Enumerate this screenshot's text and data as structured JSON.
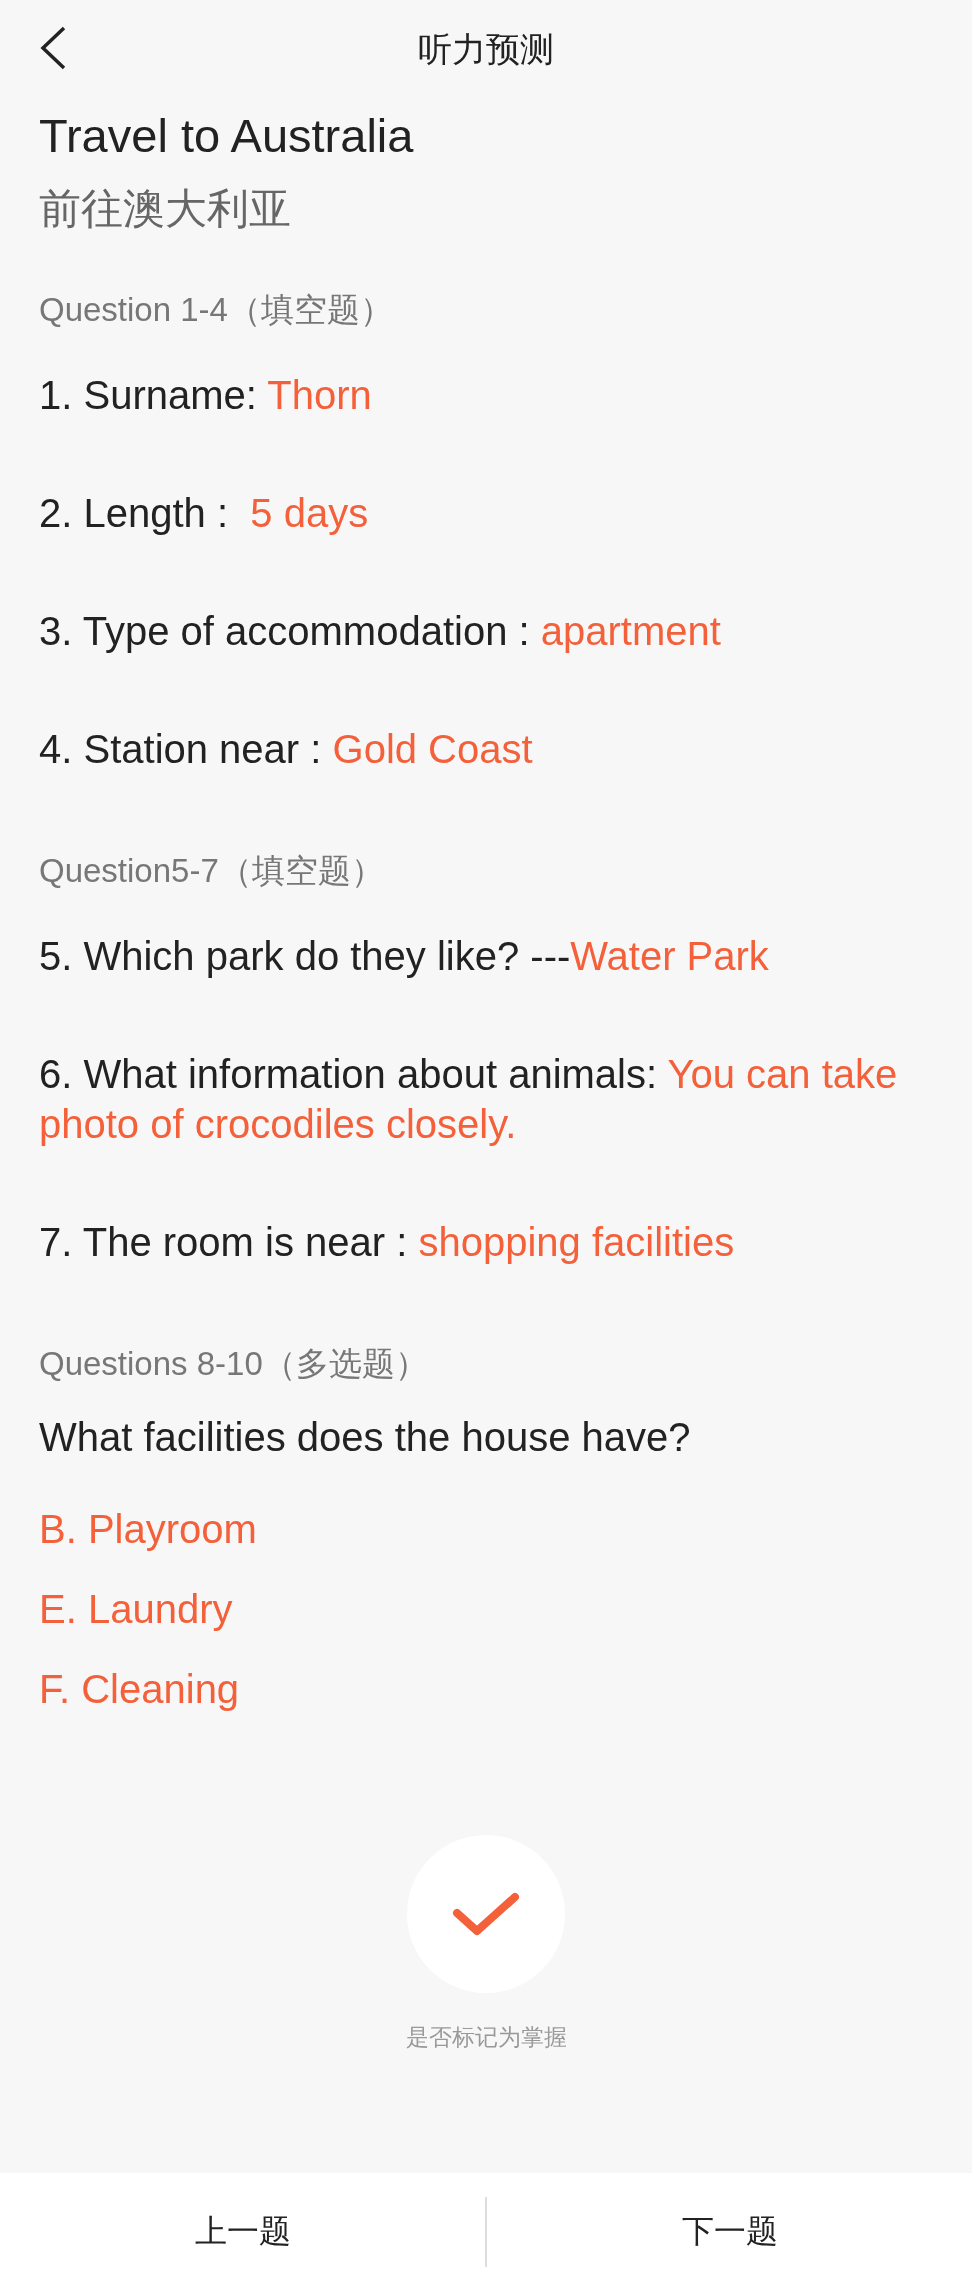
{
  "header": {
    "title": "听力预测"
  },
  "title_en": "Travel to Australia",
  "title_zh": "前往澳大利亚",
  "sections": [
    {
      "kind": "fill",
      "label": "Question 1-4（填空题）",
      "items": [
        {
          "prompt": "1. Surname: ",
          "answer": "Thorn"
        },
        {
          "prompt": "2. Length :  ",
          "answer": "5 days"
        },
        {
          "prompt": "3. Type of accommodation : ",
          "answer": "apartment"
        },
        {
          "prompt": "4. Station near : ",
          "answer": "Gold Coast"
        }
      ]
    },
    {
      "kind": "fill",
      "label": "Question5-7（填空题）",
      "items": [
        {
          "prompt": "5. Which park do they like? ---",
          "answer": "Water Park"
        },
        {
          "prompt": "6. What information about animals: ",
          "answer": "You can take photo of crocodiles closely."
        },
        {
          "prompt": "7. The room is near : ",
          "answer": "shopping facilities"
        }
      ]
    },
    {
      "kind": "choice",
      "label": "Questions 8-10（多选题）",
      "question": "What facilities does the house have?",
      "answers": [
        "B. Playroom",
        "E. Laundry",
        "F. Cleaning"
      ]
    }
  ],
  "mark": {
    "checked": true,
    "label": "是否标记为掌握"
  },
  "footer": {
    "buttons": [
      "上一题",
      "下一题"
    ]
  }
}
